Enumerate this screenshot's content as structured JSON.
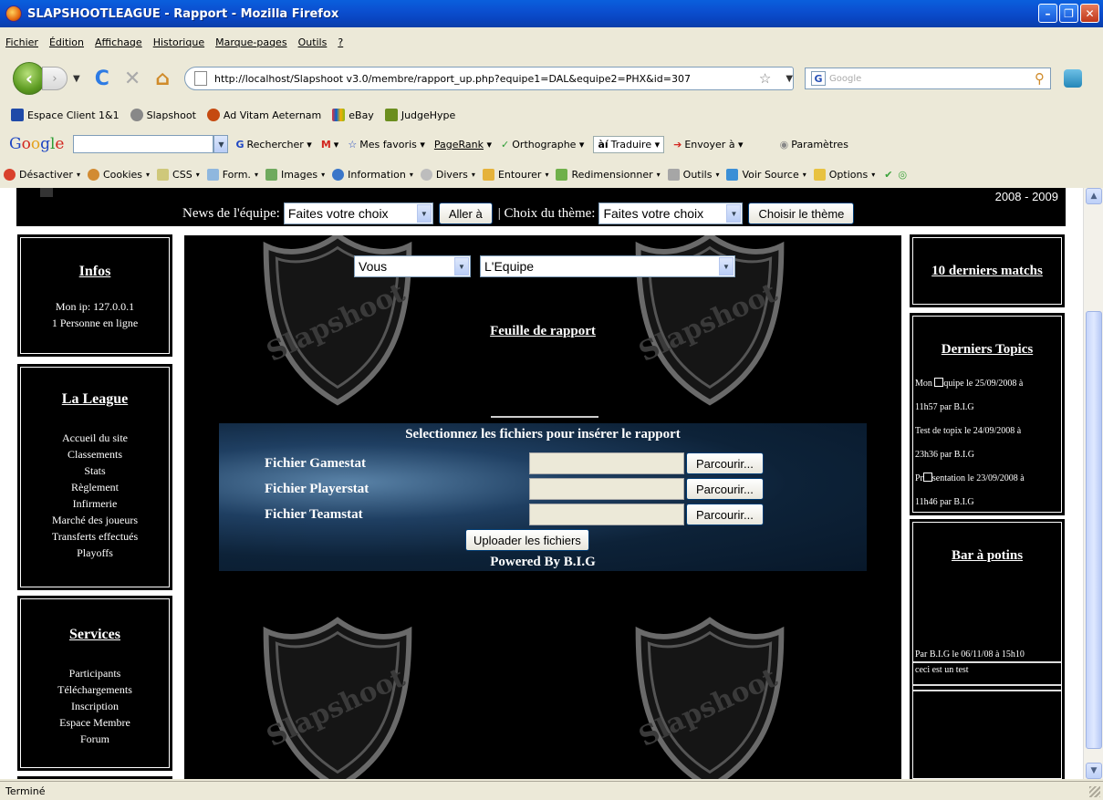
{
  "window": {
    "title": "SLAPSHOOTLEAGUE - Rapport - Mozilla Firefox"
  },
  "menu": [
    "Fichier",
    "Édition",
    "Affichage",
    "Historique",
    "Marque-pages",
    "Outils",
    "?"
  ],
  "address": {
    "url": "http://localhost/Slapshoot v3.0/membre/rapport_up.php?equipe1=DAL&equipe2=PHX&id=307"
  },
  "search": {
    "placeholder": "Google"
  },
  "bookmarks": [
    "Espace Client 1&1",
    "Slapshoot",
    "Ad Vitam Aeternam",
    "eBay",
    "JudgeHype"
  ],
  "google_toolbar": {
    "logo": [
      "G",
      "o",
      "o",
      "g",
      "l",
      "e"
    ],
    "items": [
      "Rechercher",
      "Mes favoris",
      "PageRank",
      "Orthographe",
      "Traduire",
      "Envoyer à",
      "Paramètres"
    ]
  },
  "dev_toolbar": [
    "Désactiver",
    "Cookies",
    "CSS",
    "Form.",
    "Images",
    "Information",
    "Divers",
    "Entourer",
    "Redimensionner",
    "Outils",
    "Voir Source",
    "Options"
  ],
  "header": {
    "season": "2008 - 2009",
    "news_label": "News de l'équipe:",
    "news_select": "Faites votre choix",
    "goto_button": "Aller à",
    "theme_label": "| Choix du thème:",
    "theme_select": "Faites votre choix",
    "theme_button": "Choisir le thème"
  },
  "left": {
    "infos": {
      "title": "Infos",
      "lines": [
        "Mon ip: 127.0.0.1",
        "1 Personne en ligne"
      ]
    },
    "league": {
      "title": "La League",
      "items": [
        "Accueil du site",
        "Classements",
        "Stats",
        "Règlement",
        "Infirmerie",
        "Marché des joueurs",
        "Transferts effectués",
        "Playoffs"
      ]
    },
    "services": {
      "title": "Services",
      "items": [
        "Participants",
        "Téléchargements",
        "Inscription",
        "Espace Membre",
        "Forum"
      ]
    }
  },
  "center": {
    "select_who": "Vous",
    "select_team": "L'Equipe",
    "title": "Feuille de rapport",
    "shield_text": "Slapshoot",
    "upload": {
      "title": "Selectionnez les fichiers pour insérer le rapport",
      "rows": [
        "Fichier Gamestat",
        "Fichier Playerstat",
        "Fichier Teamstat"
      ],
      "browse": "Parcourir...",
      "submit": "Uploader les fichiers",
      "powered": "Powered By B.I.G"
    }
  },
  "right": {
    "matches": {
      "title": "10 derniers matchs"
    },
    "topics": {
      "title": "Derniers Topics",
      "lines": [
        "Mon",
        "quipe le 25/09/2008 à",
        "11h57 par B.I.G",
        "Test de topix le 24/09/2008 à",
        "23h36 par B.I.G",
        "Pr",
        "sentation le 23/09/2008 à",
        "11h46 par B.I.G"
      ]
    },
    "potins": {
      "title": "Bar à potins",
      "author_line": "Par B.I.G le 06/11/08 à 15h10",
      "message": "ceci est un test"
    }
  },
  "status": {
    "text": "Terminé"
  }
}
